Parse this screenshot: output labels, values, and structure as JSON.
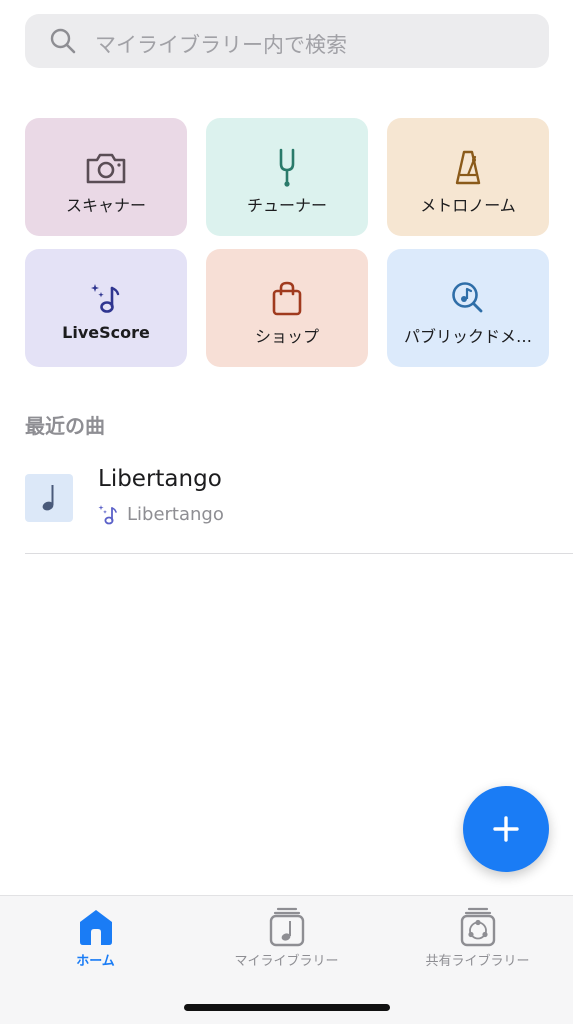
{
  "search": {
    "placeholder": "マイライブラリー内で検索"
  },
  "tools": [
    {
      "label": "スキャナー",
      "icon": "camera-icon",
      "bg": "#ead9e6",
      "icon_color": "#5a4d55"
    },
    {
      "label": "チューナー",
      "icon": "tuning-fork-icon",
      "bg": "#dcf2ee",
      "icon_color": "#2a7a6a"
    },
    {
      "label": "メトロノーム",
      "icon": "metronome-icon",
      "bg": "#f6e6d2",
      "icon_color": "#8a5a1a"
    },
    {
      "label": "LiveScore",
      "icon": "livescore-icon",
      "bg": "#e4e2f6",
      "icon_color": "#2f3590"
    },
    {
      "label": "ショップ",
      "icon": "shopping-bag-icon",
      "bg": "#f7dfd6",
      "icon_color": "#a03a1e"
    },
    {
      "label": "パブリックドメ…",
      "icon": "music-search-icon",
      "bg": "#dceafb",
      "icon_color": "#2f6ea8"
    }
  ],
  "recent": {
    "title": "最近の曲",
    "items": [
      {
        "title": "Libertango",
        "subtitle": "Libertango",
        "icon": "quarter-note-icon",
        "source_icon": "livescore-icon"
      }
    ]
  },
  "fab": {
    "icon": "plus-icon",
    "color": "#1a7cf5"
  },
  "tabs": [
    {
      "label": "ホーム",
      "icon": "home-icon",
      "active": true
    },
    {
      "label": "マイライブラリー",
      "icon": "library-icon",
      "active": false
    },
    {
      "label": "共有ライブラリー",
      "icon": "shared-library-icon",
      "active": false
    }
  ],
  "colors": {
    "accent": "#1a7cf5",
    "secondary_text": "#8e8e93"
  }
}
